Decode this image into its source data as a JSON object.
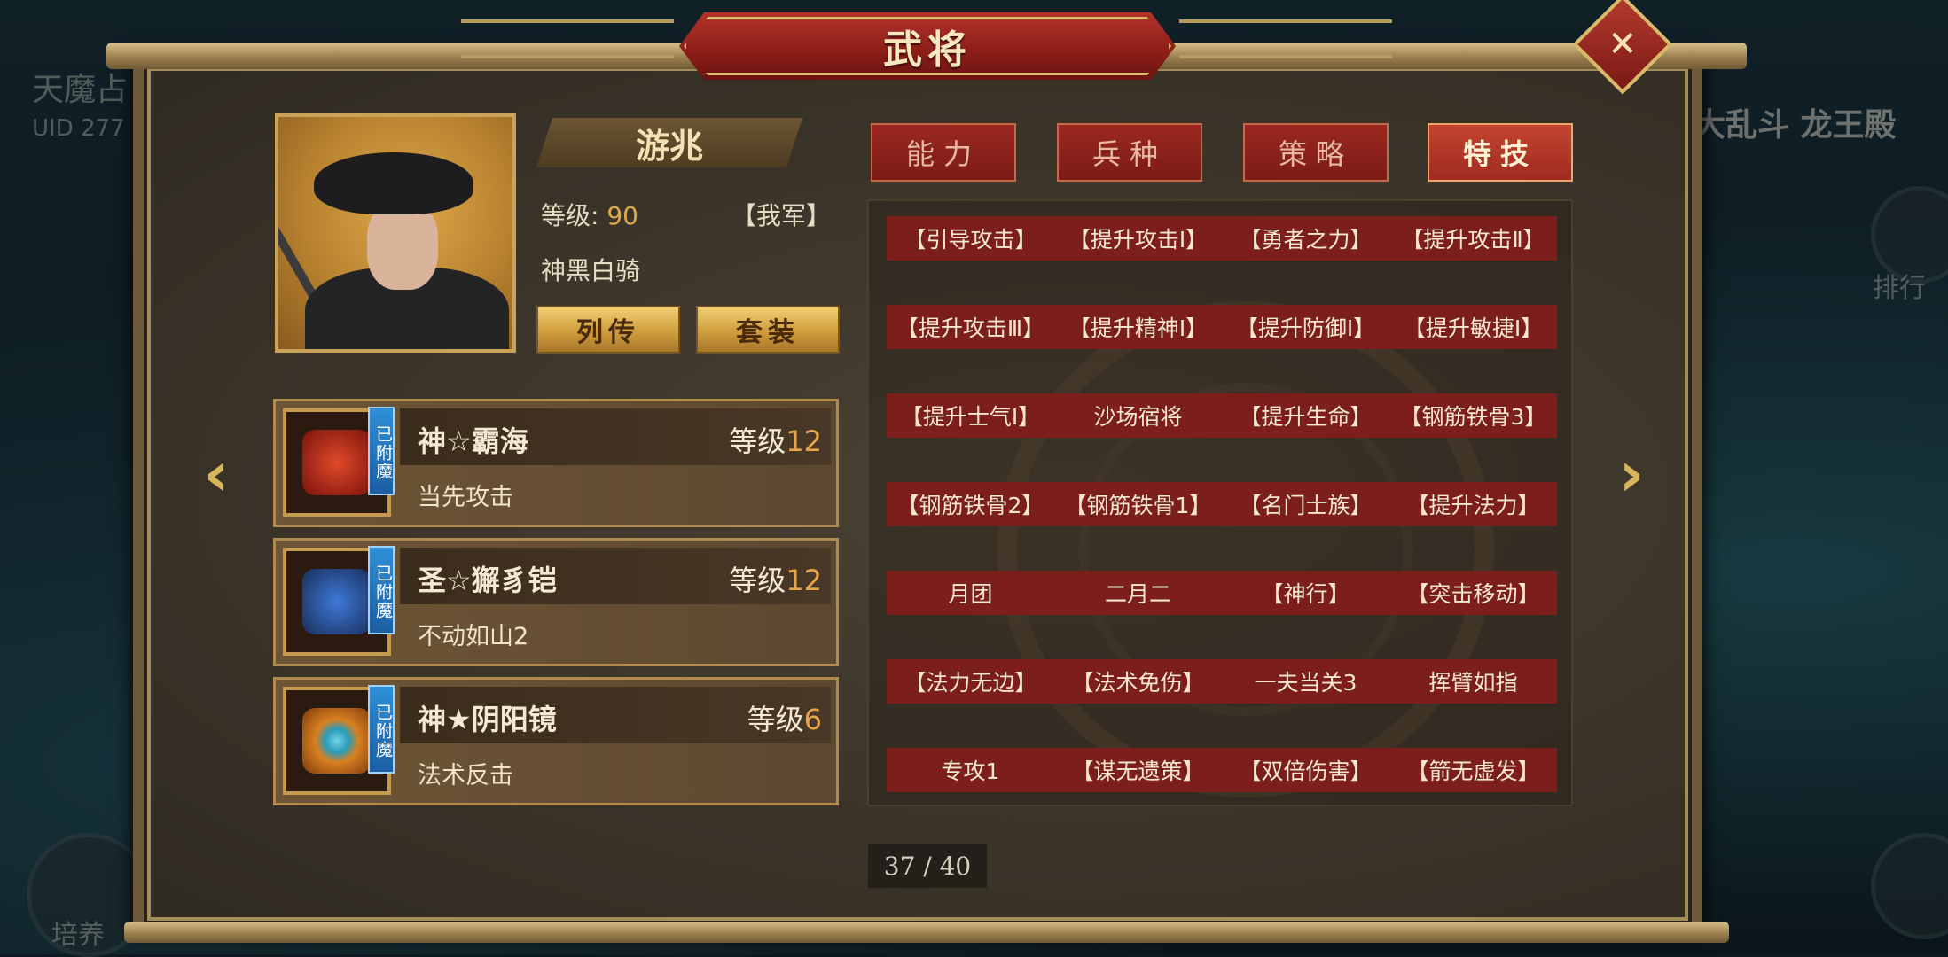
{
  "background": {
    "left_name": "天魔占",
    "left_uid": "UID  277",
    "right_event": "大乱斗 龙王殿",
    "right_rank": "排行",
    "left_bottom": "培养"
  },
  "window": {
    "title": "武将",
    "close_icon": "close-x-icon"
  },
  "general": {
    "name": "游兆",
    "level_label": "等级:",
    "level_value": "90",
    "faction": "【我军】",
    "unit_type": "神黑白骑",
    "btn_biography": "列传",
    "btn_set": "套装"
  },
  "equipment": [
    {
      "name": "神☆霸海",
      "level_label": "等级",
      "level": "12",
      "skill": "当先攻击",
      "badge": "已附魔",
      "icon": "red-sword-icon",
      "color": "#c0271e"
    },
    {
      "name": "圣☆獬豸铠",
      "level_label": "等级",
      "level": "12",
      "skill": "不动如山2",
      "badge": "已附魔",
      "icon": "blue-armor-icon",
      "color": "#2a55a8"
    },
    {
      "name": "神★阴阳镜",
      "level_label": "等级",
      "level": "6",
      "skill": "法术反击",
      "badge": "已附魔",
      "icon": "orange-mirror-icon",
      "color": "#d97a1f"
    }
  ],
  "tabs": [
    {
      "label": "能力",
      "active": false
    },
    {
      "label": "兵种",
      "active": false
    },
    {
      "label": "策略",
      "active": false
    },
    {
      "label": "特技",
      "active": true
    }
  ],
  "skills": [
    [
      "【引导攻击】",
      "【提升攻击Ⅰ】",
      "【勇者之力】",
      "【提升攻击Ⅱ】"
    ],
    [
      "【提升攻击Ⅲ】",
      "【提升精神Ⅰ】",
      "【提升防御Ⅰ】",
      "【提升敏捷Ⅰ】"
    ],
    [
      "【提升士气Ⅰ】",
      "沙场宿将",
      "【提升生命】",
      "【钢筋铁骨3】"
    ],
    [
      "【钢筋铁骨2】",
      "【钢筋铁骨1】",
      "【名门士族】",
      "【提升法力】"
    ],
    [
      "月团",
      "二月二",
      "【神行】",
      "【突击移动】"
    ],
    [
      "【法力无边】",
      "【法术免伤】",
      "一夫当关3",
      "挥臂如指"
    ],
    [
      "专攻1",
      "【谋无遗策】",
      "【双倍伤害】",
      "【箭无虚发】"
    ]
  ],
  "pager": {
    "text": "37 / 40"
  },
  "colors": {
    "accent_gold": "#d8b45a",
    "tab_red": "#9b2820",
    "skill_row": "#7c1f1c"
  }
}
